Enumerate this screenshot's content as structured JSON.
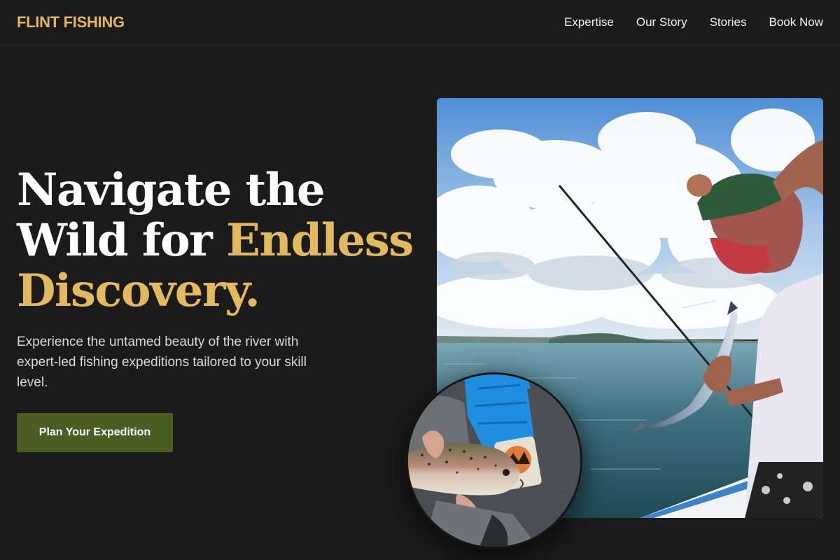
{
  "brand": {
    "name": "FLINT FISHING",
    "color": "#e3b95f"
  },
  "nav": {
    "links": [
      {
        "label": "Expertise"
      },
      {
        "label": "Our Story"
      },
      {
        "label": "Stories"
      },
      {
        "label": "Book Now"
      }
    ]
  },
  "hero": {
    "title_line1": "Navigate the",
    "title_line2_part1": "Wild for ",
    "title_line2_accent": "Endless",
    "title_line3_accent": "Discovery.",
    "subtitle": "Experience the untamed beauty of the river with expert-led fishing expeditions tailored to your skill level.",
    "cta_label": "Plan Your Expedition",
    "accent_color": "#e3b95f",
    "cta_color": "#4a5e23"
  },
  "images": {
    "main": "angler-holding-fish-photo",
    "inset": "rainbow-trout-in-hands-photo"
  }
}
